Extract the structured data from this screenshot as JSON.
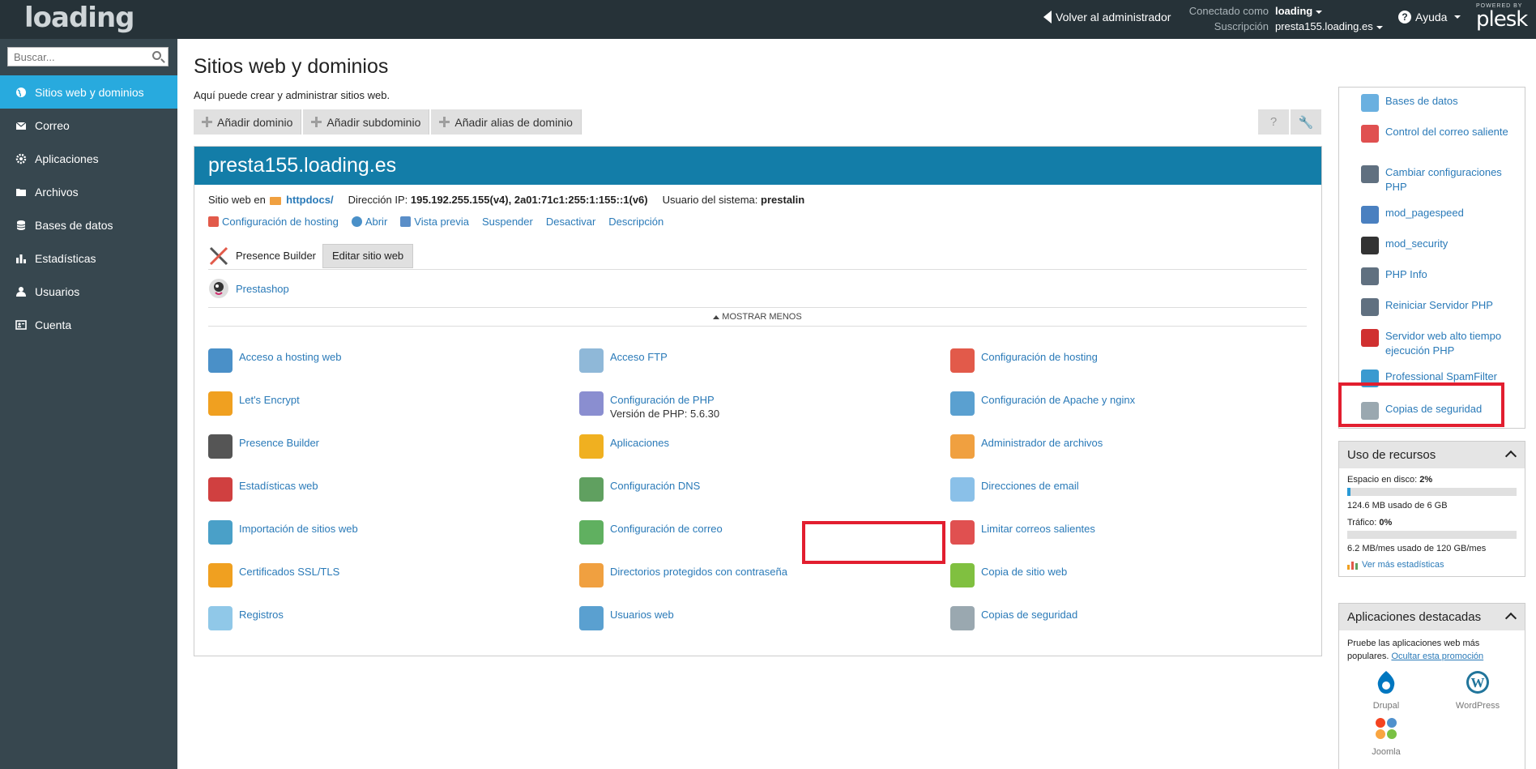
{
  "topbar": {
    "logo": "loading",
    "back_admin": "Volver al administrador",
    "connected_label": "Conectado como",
    "connected_user": "loading",
    "subscription_label": "Suscripción",
    "subscription_value": "presta155.loading.es",
    "help": "Ayuda",
    "powered_by": "POWERED BY",
    "brand": "plesk"
  },
  "sidebar": {
    "search_placeholder": "Buscar...",
    "items": [
      {
        "label": "Sitios web y dominios",
        "icon": "globe-icon",
        "active": true
      },
      {
        "label": "Correo",
        "icon": "envelope-icon"
      },
      {
        "label": "Aplicaciones",
        "icon": "gear-icon"
      },
      {
        "label": "Archivos",
        "icon": "folder-icon"
      },
      {
        "label": "Bases de datos",
        "icon": "database-icon"
      },
      {
        "label": "Estadísticas",
        "icon": "bar-chart-icon"
      },
      {
        "label": "Usuarios",
        "icon": "user-icon"
      },
      {
        "label": "Cuenta",
        "icon": "id-card-icon"
      }
    ]
  },
  "main": {
    "title": "Sitios web y dominios",
    "description": "Aquí puede crear y administrar sitios web.",
    "toolbar": [
      "Añadir dominio",
      "Añadir subdominio",
      "Añadir alias de dominio"
    ],
    "domain": {
      "name": "presta155.loading.es",
      "website_at_label": "Sitio web en",
      "website_folder": "httpdocs/",
      "ip_label": "Dirección IP:",
      "ip_value": "195.192.255.155(v4), 2a01:71c1:255:1:155::1(v6)",
      "sysuser_label": "Usuario del sistema:",
      "sysuser_value": "prestalin",
      "links": [
        "Configuración de hosting",
        "Abrir",
        "Vista previa",
        "Suspender",
        "Desactivar",
        "Descripción"
      ],
      "presence_builder": "Presence Builder",
      "edit_site": "Editar sitio web",
      "prestashop": "Prestashop",
      "show_less": "MOSTRAR MENOS"
    },
    "tools": [
      {
        "label": "Acceso a hosting web",
        "icon": "globe-flag-icon",
        "color": "#4a90c8"
      },
      {
        "label": "Acceso FTP",
        "icon": "ftp-icon",
        "color": "#8fb8d8"
      },
      {
        "label": "Configuración de hosting",
        "icon": "hosting-config-icon",
        "color": "#e25a4a"
      },
      {
        "label": "Let's Encrypt",
        "icon": "lock-icon",
        "color": "#f0a020"
      },
      {
        "label": "Configuración de PHP",
        "sub": "Versión de PHP: 5.6.30",
        "icon": "php-icon",
        "color": "#8a8ed0"
      },
      {
        "label": "Configuración de Apache y nginx",
        "icon": "apache-icon",
        "color": "#5aa0d0"
      },
      {
        "label": "Presence Builder",
        "icon": "tools-icon",
        "color": "#555555"
      },
      {
        "label": "Aplicaciones",
        "icon": "gear-icon",
        "color": "#f0b020"
      },
      {
        "label": "Administrador de archivos",
        "icon": "folder-icon",
        "color": "#f0a040"
      },
      {
        "label": "Estadísticas web",
        "icon": "bar-chart-icon",
        "color": "#d04040"
      },
      {
        "label": "Configuración DNS",
        "icon": "dns-flags-icon",
        "color": "#60a060"
      },
      {
        "label": "Direcciones de email",
        "icon": "envelope-icon",
        "color": "#8ac0e8"
      },
      {
        "label": "Importación de sitios web",
        "icon": "import-icon",
        "color": "#4aa0c8"
      },
      {
        "label": "Configuración de correo",
        "icon": "mail-config-icon",
        "color": "#60b060"
      },
      {
        "label": "Limitar correos salientes",
        "icon": "mail-limit-icon",
        "color": "#e05050"
      },
      {
        "label": "Certificados SSL/TLS",
        "icon": "certificate-icon",
        "color": "#f0a020"
      },
      {
        "label": "Directorios protegidos con contraseña",
        "icon": "protected-folder-icon",
        "color": "#f0a040"
      },
      {
        "label": "Copia de sitio web",
        "icon": "copy-site-icon",
        "color": "#80c040"
      },
      {
        "label": "Registros",
        "icon": "logs-icon",
        "color": "#90c8e8"
      },
      {
        "label": "Usuarios web",
        "icon": "web-users-icon",
        "color": "#5aa0d0"
      },
      {
        "label": "Copias de seguridad",
        "icon": "backup-icon",
        "color": "#9aa8b0"
      }
    ]
  },
  "right": {
    "links": [
      {
        "label": "Bases de datos",
        "icon": "database-icon",
        "color": "#6ab0e0"
      },
      {
        "label": "Control del correo saliente",
        "icon": "mail-limit-icon",
        "color": "#e05050"
      },
      {
        "label": "Cambiar configuraciones PHP",
        "icon": "php-gear-icon",
        "color": "#607080"
      },
      {
        "label": "mod_pagespeed",
        "icon": "pagespeed-icon",
        "color": "#4a80c0"
      },
      {
        "label": "mod_security",
        "icon": "shield-icon",
        "color": "#333333"
      },
      {
        "label": "PHP Info",
        "icon": "php-info-icon",
        "color": "#607080"
      },
      {
        "label": "Reiniciar Servidor PHP",
        "icon": "php-restart-icon",
        "color": "#607080"
      },
      {
        "label": "Servidor web alto tiempo ejecución PHP",
        "icon": "stopwatch-icon",
        "color": "#d03030"
      },
      {
        "label": "Professional SpamFilter",
        "icon": "spamfilter-icon",
        "color": "#3a9ad0"
      },
      {
        "label": "Copias de seguridad",
        "icon": "backup-icon",
        "color": "#9aa8b0"
      }
    ],
    "resources": {
      "title": "Uso de recursos",
      "disk_label": "Espacio en disco:",
      "disk_pct": "2%",
      "disk_fraction": 0.02,
      "disk_detail": "124.6 MB usado de 6 GB",
      "traffic_label": "Tráfico:",
      "traffic_pct": "0%",
      "traffic_fraction": 0.0,
      "traffic_detail": "6.2 MB/mes usado de 120 GB/mes",
      "more_stats": "Ver más estadísticas"
    },
    "featured": {
      "title": "Aplicaciones destacadas",
      "text": "Pruebe las aplicaciones web más populares.",
      "hide_link": "Ocultar esta promoción",
      "apps": [
        {
          "label": "Drupal",
          "icon": "drupal-icon",
          "color": "#0077c0"
        },
        {
          "label": "WordPress",
          "icon": "wordpress-icon",
          "color": "#21759b"
        },
        {
          "label": "Joomla",
          "icon": "joomla-icon",
          "color": "#f44321"
        }
      ]
    }
  },
  "colors": {
    "topbar": "#263238",
    "sidebar": "#37474f",
    "active": "#28aade",
    "domain_header": "#137da8",
    "highlight": "#e21e2f",
    "link": "#2a7ab8"
  }
}
